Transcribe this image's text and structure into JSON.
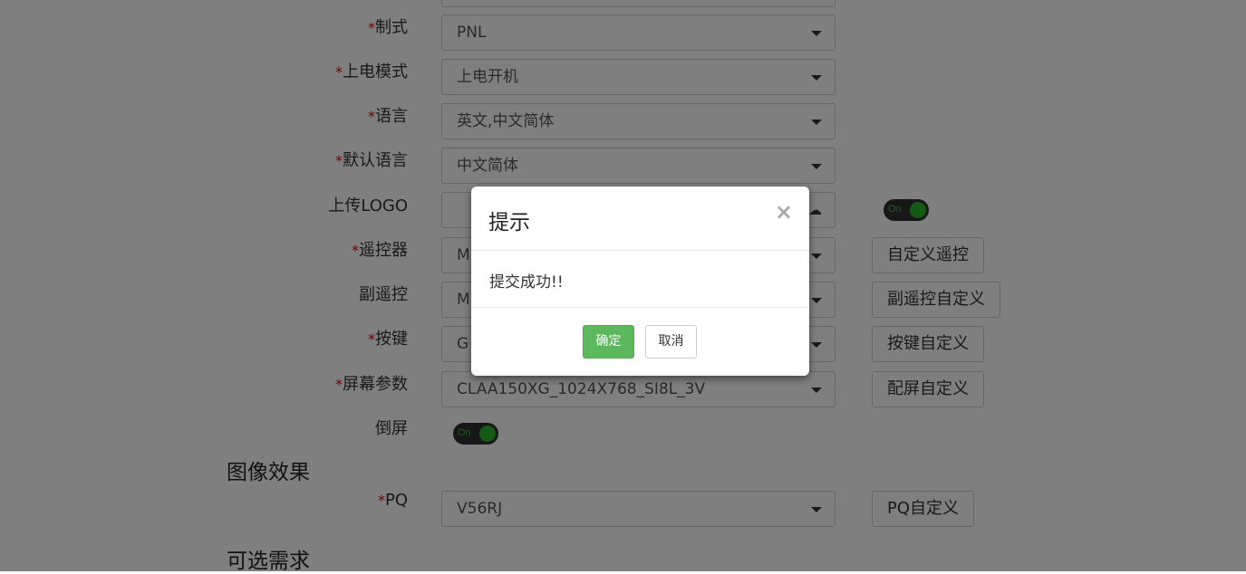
{
  "form": {
    "top_partial_field": "",
    "fields": [
      {
        "label": "制式",
        "required": true,
        "value": "PNL"
      },
      {
        "label": "上电模式",
        "required": true,
        "value": "上电开机"
      },
      {
        "label": "语言",
        "required": true,
        "value": "英文,中文简体"
      },
      {
        "label": "默认语言",
        "required": true,
        "value": "中文简体"
      },
      {
        "label": "上传LOGO",
        "required": false,
        "value": "",
        "toggle": "On"
      },
      {
        "label": "遥控器",
        "required": true,
        "value": "M",
        "button": "自定义遥控"
      },
      {
        "label": "副遥控",
        "required": false,
        "value": "M",
        "button": "副遥控自定义"
      },
      {
        "label": "按键",
        "required": true,
        "value": "G",
        "button": "按键自定义"
      },
      {
        "label": "屏幕参数",
        "required": true,
        "value": "CLAA150XG_1024X768_SI8L_3V",
        "button": "配屏自定义"
      },
      {
        "label": "倒屏",
        "required": false,
        "toggle": "On"
      }
    ],
    "required_mark": "*",
    "upload_icon": "cloud-upload-icon"
  },
  "section_image": {
    "title": "图像效果",
    "pq_label": "PQ",
    "pq_value": "V56RJ",
    "pq_button": "PQ自定义"
  },
  "section_optional": {
    "title": "可选需求"
  },
  "modal": {
    "title": "提示",
    "close": "×",
    "message": "提交成功!!",
    "ok_label": "确定",
    "cancel_label": "取消"
  },
  "colors": {
    "ok_button": "#5cb85c",
    "toggle_on": "#28b528",
    "required": "#ee0000"
  }
}
